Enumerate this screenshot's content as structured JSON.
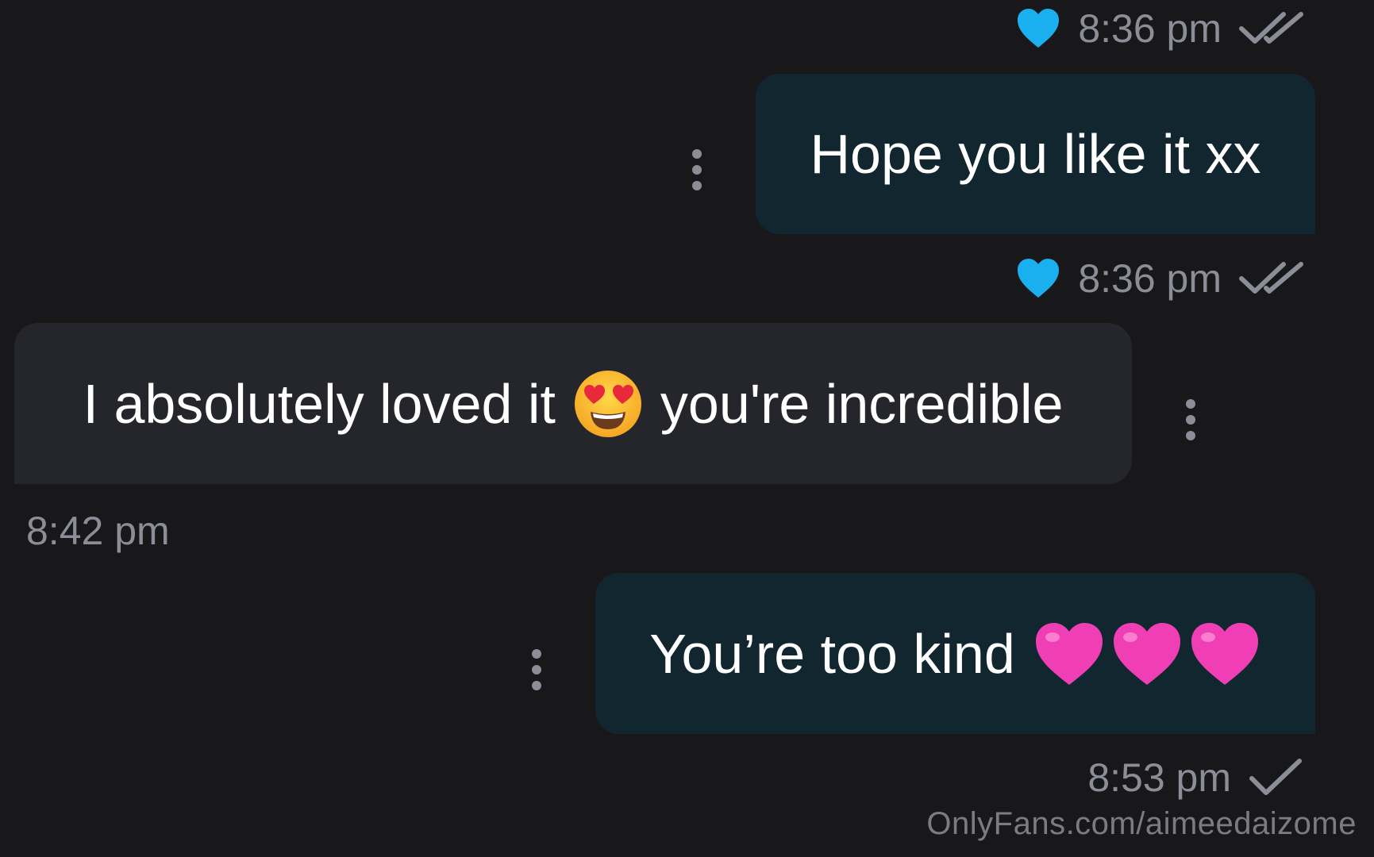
{
  "messages": [
    {
      "direction": "outgoing",
      "text": "Hope you like it xx",
      "time": "8:36 pm",
      "liked": true,
      "status": "read"
    },
    {
      "direction": "incoming",
      "text_before": "I absolutely loved it",
      "emoji": "smiling-face-with-heart-eyes",
      "text_after": "you're incredible",
      "time": "8:42 pm"
    },
    {
      "direction": "outgoing",
      "text": "You’re too kind",
      "emoji": [
        "pink-heart",
        "pink-heart",
        "pink-heart"
      ],
      "time": "8:53 pm",
      "status": "sent"
    }
  ],
  "top_meta": {
    "time": "8:36 pm",
    "liked": true,
    "status": "read"
  },
  "watermark": "OnlyFans.com/aimeedaizome",
  "colors": {
    "background": "#18181b",
    "outgoing_bubble": "#122630",
    "incoming_bubble": "#25262b",
    "like_heart": "#1ab0f0",
    "pink_heart": "#f03fb5",
    "meta_text": "#8b8e96"
  }
}
